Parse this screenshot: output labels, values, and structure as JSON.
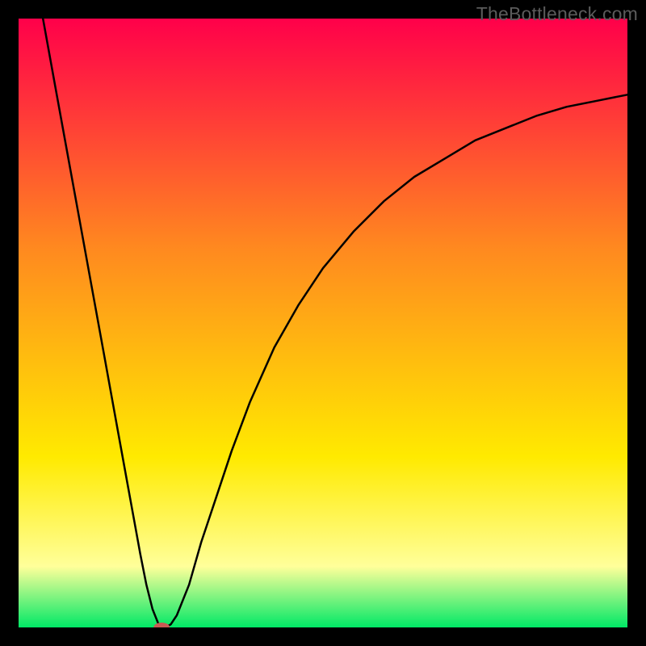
{
  "watermark": "TheBottleneck.com",
  "chart_data": {
    "type": "line",
    "title": "",
    "xlabel": "",
    "ylabel": "",
    "xlim": [
      0,
      100
    ],
    "ylim": [
      0,
      100
    ],
    "grid": false,
    "background": {
      "top_color": "#ff004a",
      "orange": "#ff8a1f",
      "yellow": "#ffea00",
      "pale_yellow": "#ffff9a",
      "bottom_color": "#00e866",
      "upper_is": "bad",
      "lower_is": "good"
    },
    "series": [
      {
        "name": "bottleneck-curve",
        "x": [
          4,
          6,
          8,
          10,
          12,
          14,
          16,
          18,
          20,
          21,
          22,
          23,
          24,
          25,
          26,
          28,
          30,
          32,
          35,
          38,
          42,
          46,
          50,
          55,
          60,
          65,
          70,
          75,
          80,
          85,
          90,
          95,
          100
        ],
        "y": [
          100,
          89,
          78,
          67,
          56,
          45,
          34,
          23,
          12,
          7,
          3,
          0.5,
          0,
          0.5,
          2,
          7,
          14,
          20,
          29,
          37,
          46,
          53,
          59,
          65,
          70,
          74,
          77,
          80,
          82,
          84,
          85.5,
          86.5,
          87.5
        ]
      }
    ],
    "marker": {
      "name": "optimal-point",
      "x": 23.5,
      "y": 0,
      "color": "#c85a54",
      "rx": 10,
      "ry": 6
    },
    "plot_frame": {
      "border_color": "#000000",
      "border_width": 23
    }
  }
}
